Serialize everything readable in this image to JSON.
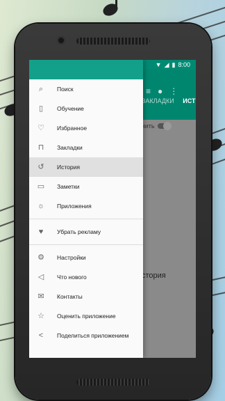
{
  "status_bar": {
    "time": "8:00"
  },
  "background_screen": {
    "tabs": [
      "ЗАКЛАДКИ",
      "ИСТ"
    ],
    "toggle_label": "чить",
    "history_text": "стория"
  },
  "drawer": {
    "group1": [
      {
        "label": "Поиск",
        "icon": "search-icon"
      },
      {
        "label": "Обучение",
        "icon": "cards-icon"
      },
      {
        "label": "Избранное",
        "icon": "heart-icon"
      },
      {
        "label": "Закладки",
        "icon": "bookmark-icon"
      },
      {
        "label": "История",
        "icon": "history-icon",
        "selected": true
      },
      {
        "label": "Заметки",
        "icon": "note-icon"
      },
      {
        "label": "Приложения",
        "icon": "lightbulb-icon"
      }
    ],
    "group2": [
      {
        "label": "Убрать рекламу",
        "icon": "heart-filled-icon"
      }
    ],
    "group3": [
      {
        "label": "Настройки",
        "icon": "gear-icon"
      },
      {
        "label": "Что нового",
        "icon": "megaphone-icon"
      },
      {
        "label": "Контакты",
        "icon": "mail-icon"
      },
      {
        "label": "Оценить приложение",
        "icon": "star-icon"
      },
      {
        "label": "Поделиться приложением",
        "icon": "share-icon"
      }
    ]
  }
}
